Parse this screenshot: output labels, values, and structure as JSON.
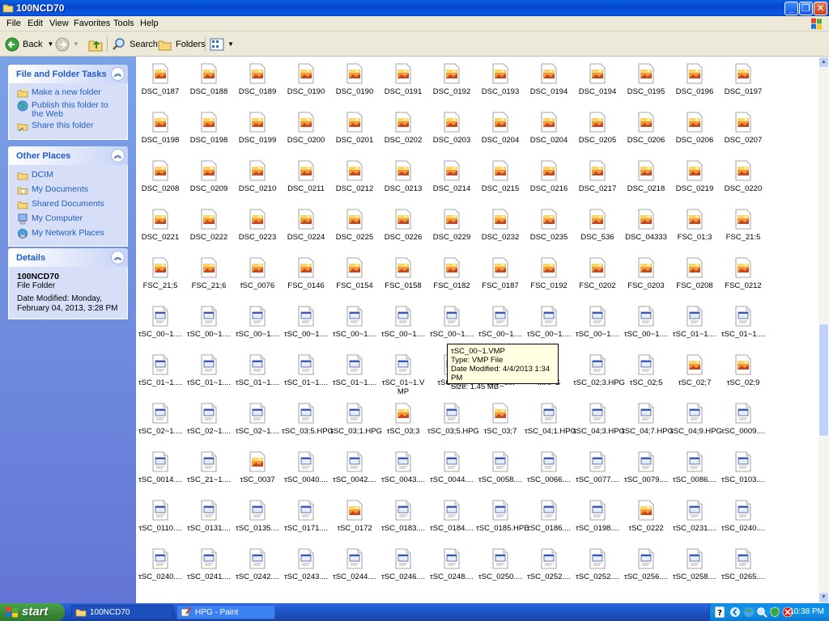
{
  "window": {
    "title": "100NCD70"
  },
  "menu": [
    "File",
    "Edit",
    "View",
    "Favorites",
    "Tools",
    "Help"
  ],
  "toolbar": {
    "back": "Back",
    "search": "Search",
    "folders": "Folders"
  },
  "sidebar": {
    "tasks": {
      "title": "File and Folder Tasks",
      "items": [
        "Make a new folder",
        "Publish this folder to the Web",
        "Share this folder"
      ]
    },
    "places": {
      "title": "Other Places",
      "items": [
        "DCIM",
        "My Documents",
        "Shared Documents",
        "My Computer",
        "My Network Places"
      ]
    },
    "details": {
      "title": "Details",
      "name": "100NCD70",
      "type": "File Folder",
      "modified": "Date Modified: Monday, February 04, 2013, 3:28 PM"
    }
  },
  "file_rows": [
    [
      "DSC_0187",
      "DSC_0188",
      "DSC_0189",
      "DSC_0190",
      "DSC_0190",
      "DSC_0191",
      "DSC_0192",
      "DSC_0193",
      "DSC_0194",
      "DSC_0194",
      "DSC_0195",
      "DSC_0196",
      "DSC_0197"
    ],
    [
      "DSC_0198",
      "DSC_0198",
      "DSC_0199",
      "DSC_0200",
      "DSC_0201",
      "DSC_0202",
      "DSC_0203",
      "DSC_0204",
      "DSC_0204",
      "DSC_0205",
      "DSC_0206",
      "DSC_0206",
      "DSC_0207"
    ],
    [
      "DSC_0208",
      "DSC_0209",
      "DSC_0210",
      "DSC_0211",
      "DSC_0212",
      "DSC_0213",
      "DSC_0214",
      "DSC_0215",
      "DSC_0216",
      "DSC_0217",
      "DSC_0218",
      "DSC_0219",
      "DSC_0220"
    ],
    [
      "DSC_0221",
      "DSC_0222",
      "DSC_0223",
      "DSC_0224",
      "DSC_0225",
      "DSC_0226",
      "DSC_0229",
      "DSC_0232",
      "DSC_0235",
      "DSC_536",
      "DSC_04333",
      "FSC_01;3",
      "FSC_21:5"
    ],
    [
      "FSC_21;5",
      "FSC_21;6",
      "fSC_0076",
      "FSC_0146",
      "FSC_0154",
      "FSC_0158",
      "FSC_0182",
      "FSC_0187",
      "FSC_0192",
      "FSC_0202",
      "FSC_0203",
      "FSC_0208",
      "FSC_0212"
    ],
    [
      "τSC_00~1....",
      "τSC_00~1....",
      "τSC_00~1....",
      "τSC_00~1....",
      "τSC_00~1....",
      "τSC_00~1....",
      "τSC_00~1....",
      "τSC_00~1....",
      "τSC_00~1....",
      "τSC_00~1....",
      "τSC_00~1....",
      "τSC_01~1....",
      "τSC_01~1...."
    ],
    [
      "τSC_01~1....",
      "τSC_01~1....",
      "τSC_01~1....",
      "τSC_01~1....",
      "τSC_01~1....",
      "τSC_01~1.VMP",
      "τSC_0...",
      "τSC_0...",
      "...HPG",
      "τSC_02;3.HPG",
      "τSC_02;5",
      "τSC_02;7",
      "τSC_02;9"
    ],
    [
      "τSC_02~1....",
      "τSC_02~1....",
      "τSC_02~1....",
      "τSC_03;5.HPG",
      "τSC_03;1.HPG",
      "τSC_03;3",
      "τSC_03;5.HPG",
      "τSC_03;7",
      "τSC_04;1.HPG",
      "τSC_04;3.HPG",
      "τSC_04;7.HPG",
      "τSC_04;9.HPG",
      "τSC_0009...."
    ],
    [
      "τSC_0014....",
      "τSC_21~1....",
      "τSC_0037",
      "τSC_0040....",
      "τSC_0042....",
      "τSC_0043....",
      "τSC_0044....",
      "τSC_0058....",
      "τSC_0066....",
      "τSC_0077....",
      "τSC_0079....",
      "τSC_0086....",
      "τSC_0103...."
    ],
    [
      "τSC_0110....",
      "τSC_0131....",
      "τSC_0135....",
      "τSC_0171....",
      "τSC_0172",
      "τSC_0183....",
      "τSC_0184....",
      "τSC_0185.HPE",
      "τSC_0186....",
      "τSC_0198....",
      "τSC_0222",
      "τSC_0231....",
      "τSC_0240...."
    ],
    [
      "τSC_0240....",
      "τSC_0241....",
      "τSC_0242....",
      "τSC_0243....",
      "τSC_0244....",
      "τSC_0246....",
      "τSC_0248....",
      "τSC_0250....",
      "τSC_0252....",
      "τSC_0252....",
      "τSC_0256....",
      "τSC_0258....",
      "τSC_0265...."
    ]
  ],
  "photo_cells_in_doc_rows": {
    "6": [
      11,
      12
    ],
    "7": [
      5,
      7
    ],
    "8": [
      2
    ],
    "9": [
      4,
      10
    ]
  },
  "tooltip": {
    "name": "τSC_00~1.VMP",
    "type": "Type: VMP File",
    "modified": "Date Modified: 4/4/2013 1:34 PM",
    "size": "Size: 1.45 MB"
  },
  "taskbar": {
    "start": "start",
    "tasks": [
      "100NCD70",
      "HPG - Paint"
    ],
    "clock": "10:38 PM"
  },
  "colors": {
    "sidebar_top": "#7ba2e7",
    "sidebar_bottom": "#6375d6",
    "panel_title": "#215dc6",
    "titlebar": "#0a5fe0",
    "start_button": "#3b8a3b"
  }
}
